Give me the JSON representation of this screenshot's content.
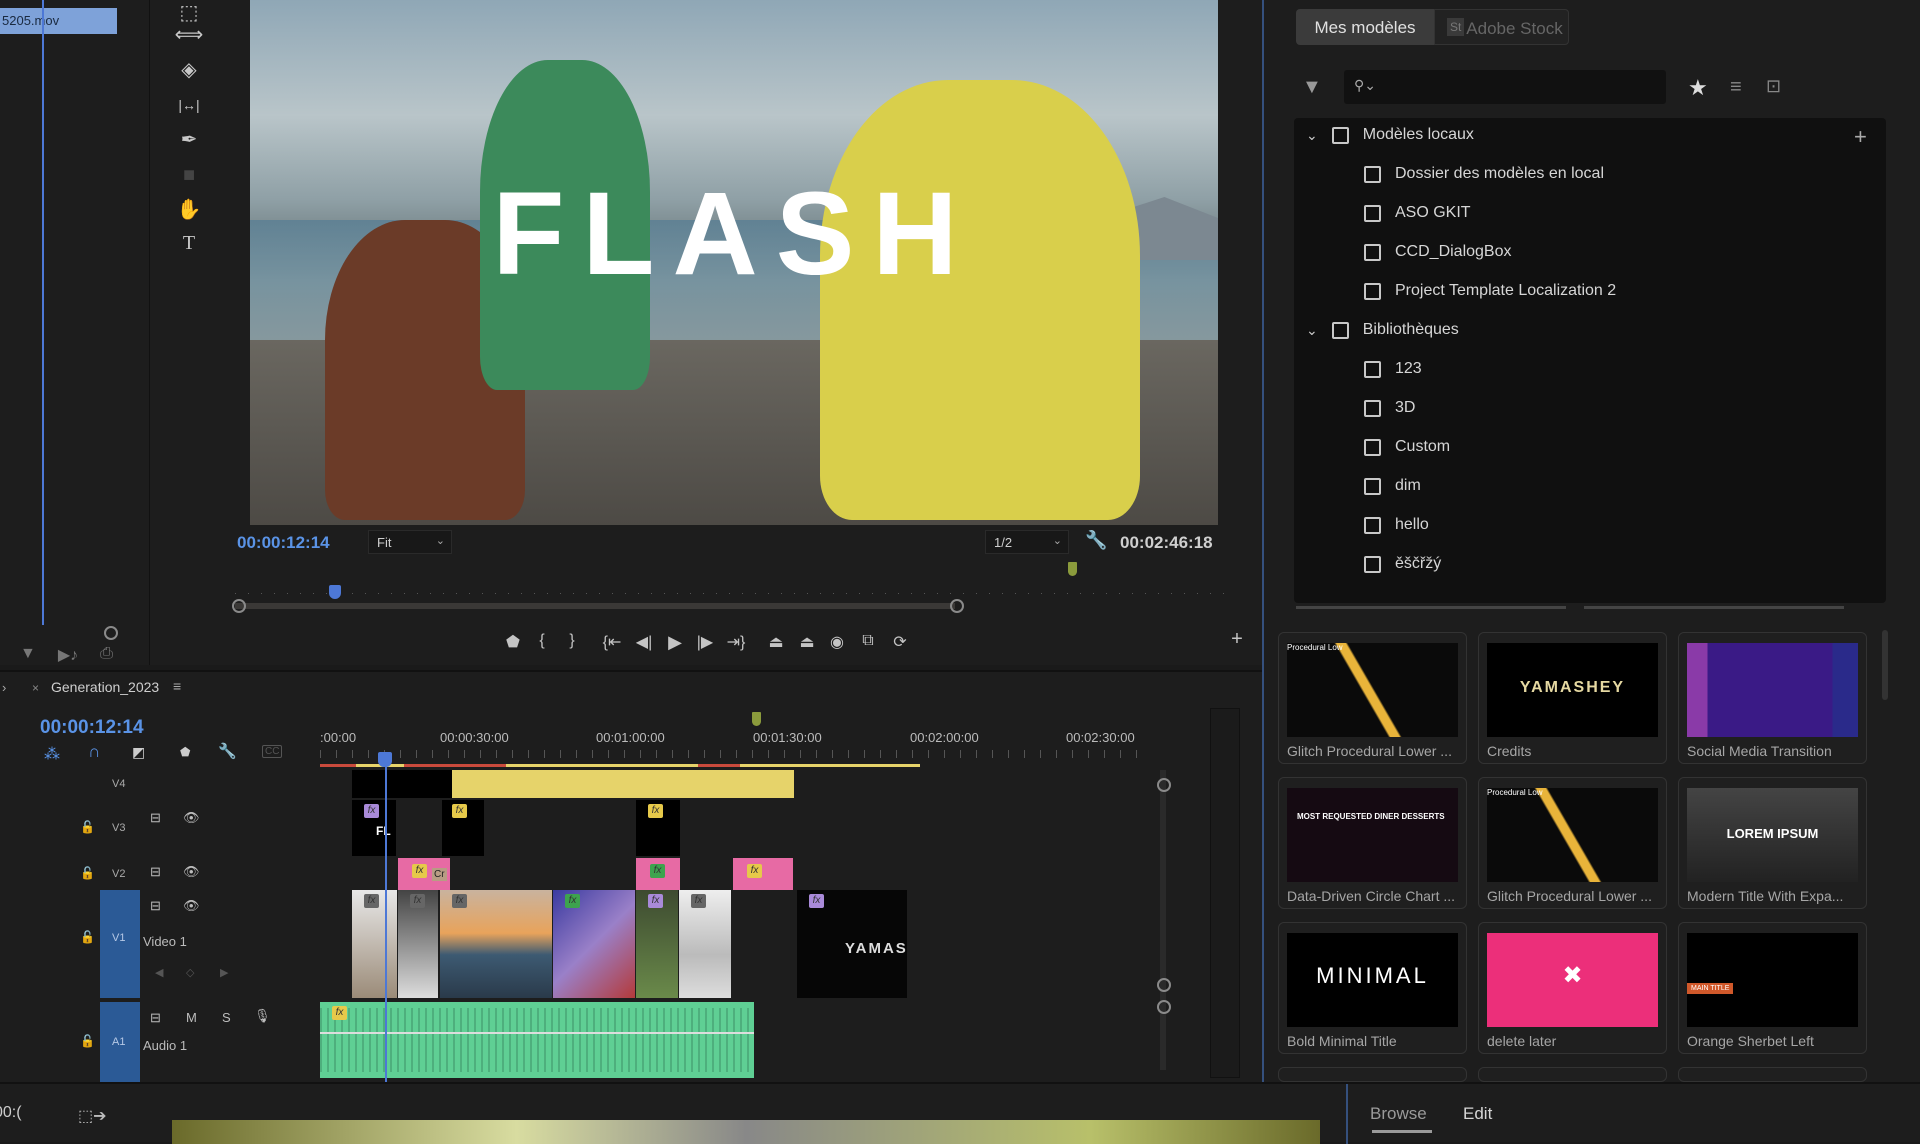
{
  "source_panel": {
    "clip_name": "5205.mov",
    "icons": [
      "filter-icon",
      "insert-audio-icon",
      "export-icon"
    ]
  },
  "tools": [
    {
      "name": "track-select-icon",
      "glyph": "⬚"
    },
    {
      "name": "ripple-edit-icon",
      "glyph": "⟺"
    },
    {
      "name": "razor-icon",
      "glyph": "◈"
    },
    {
      "name": "slip-icon",
      "glyph": "|↔|"
    },
    {
      "name": "pen-icon",
      "glyph": "✒"
    },
    {
      "name": "rectangle-icon",
      "glyph": "■"
    },
    {
      "name": "hand-icon",
      "glyph": "✋"
    },
    {
      "name": "type-icon",
      "glyph": "T"
    }
  ],
  "program_monitor": {
    "overlay_title": "FLASH",
    "current_timecode": "00:00:12:14",
    "zoom_select": "Fit",
    "resolution_select": "1/2",
    "duration_timecode": "00:02:46:18",
    "playhead_fraction": 0.1,
    "transport": [
      {
        "name": "add-marker-icon",
        "glyph": "⬟"
      },
      {
        "name": "mark-in-icon",
        "glyph": "{"
      },
      {
        "name": "mark-out-icon",
        "glyph": "}"
      },
      {
        "name": "go-to-in-icon",
        "glyph": "{⇤"
      },
      {
        "name": "step-back-icon",
        "glyph": "◀|"
      },
      {
        "name": "play-icon",
        "glyph": "▶"
      },
      {
        "name": "step-forward-icon",
        "glyph": "|▶"
      },
      {
        "name": "go-to-out-icon",
        "glyph": "⇥}"
      },
      {
        "name": "lift-icon",
        "glyph": "⏏"
      },
      {
        "name": "extract-icon",
        "glyph": "⏏"
      },
      {
        "name": "export-frame-icon",
        "glyph": "◉"
      },
      {
        "name": "comparison-view-icon",
        "glyph": "⧉"
      },
      {
        "name": "proxy-toggle-icon",
        "glyph": "⟳"
      }
    ],
    "add_button": "+"
  },
  "timeline": {
    "sequence_name": "Generation_2023",
    "timecode": "00:00:12:14",
    "ruler_labels": [
      ":00:00",
      "00:00:30:00",
      "00:01:00:00",
      "00:01:30:00",
      "00:02:00:00",
      "00:02:30:00"
    ],
    "tracks": [
      {
        "id": "V4",
        "label": ""
      },
      {
        "id": "V3",
        "label": ""
      },
      {
        "id": "V2",
        "label": ""
      },
      {
        "id": "V1",
        "label": "Video 1"
      },
      {
        "id": "A1",
        "label": "Audio 1"
      }
    ],
    "v3_clip_text": "FL",
    "v2_clip_text": "Cr",
    "v1_credit_text": "YAMAS",
    "audio_buttons": [
      "M",
      "S"
    ],
    "fx": "fx"
  },
  "templates_panel": {
    "segments": [
      "Mes modèles",
      "Adobe Stock"
    ],
    "stock_badge": "St",
    "search_placeholder": "",
    "tree": [
      {
        "label": "Modèles locaux",
        "level": 0,
        "expanded": true
      },
      {
        "label": "Dossier des modèles en local",
        "level": 1
      },
      {
        "label": "ASO GKIT",
        "level": 1
      },
      {
        "label": "CCD_DialogBox",
        "level": 1
      },
      {
        "label": "Project Template Localization 2",
        "level": 1
      },
      {
        "label": "Bibliothèques",
        "level": 0,
        "expanded": true
      },
      {
        "label": "123",
        "level": 1
      },
      {
        "label": "3D",
        "level": 1
      },
      {
        "label": "Custom",
        "level": 1
      },
      {
        "label": "dim",
        "level": 1
      },
      {
        "label": "hello",
        "level": 1
      },
      {
        "label": "ěščřžý",
        "level": 1
      }
    ],
    "cards": [
      {
        "title": "Glitch Procedural Lower ...",
        "thumb_text": "Procedural Low"
      },
      {
        "title": "Credits",
        "thumb_text": "YAMASHEY"
      },
      {
        "title": "Social Media Transition",
        "thumb_text": ""
      },
      {
        "title": "Data-Driven Circle Chart ...",
        "thumb_text": "MOST REQUESTED DINER DESSERTS"
      },
      {
        "title": "Glitch Procedural Lower ...",
        "thumb_text": "Procedural Low"
      },
      {
        "title": "Modern Title With Expa...",
        "thumb_text": "LOREM IPSUM"
      },
      {
        "title": "Bold Minimal Title",
        "thumb_text": "MINIMAL"
      },
      {
        "title": "delete later",
        "thumb_text": "✖"
      },
      {
        "title": "Orange Sherbet Left",
        "thumb_text": "MAIN TITLE"
      }
    ]
  },
  "bottom": {
    "tabs": [
      "Browse",
      "Edit"
    ],
    "active_tab": "Browse",
    "timecode_fragment": "00:("
  },
  "colors": {
    "accent_blue": "#5a93e6",
    "track_target_blue": "#2b5a96",
    "v4_clip_yellow": "#e6d36a",
    "v2_clip_pink": "#e76aa4",
    "audio_green": "#5fcf94",
    "delete_later_pink": "#ec2f7a"
  }
}
